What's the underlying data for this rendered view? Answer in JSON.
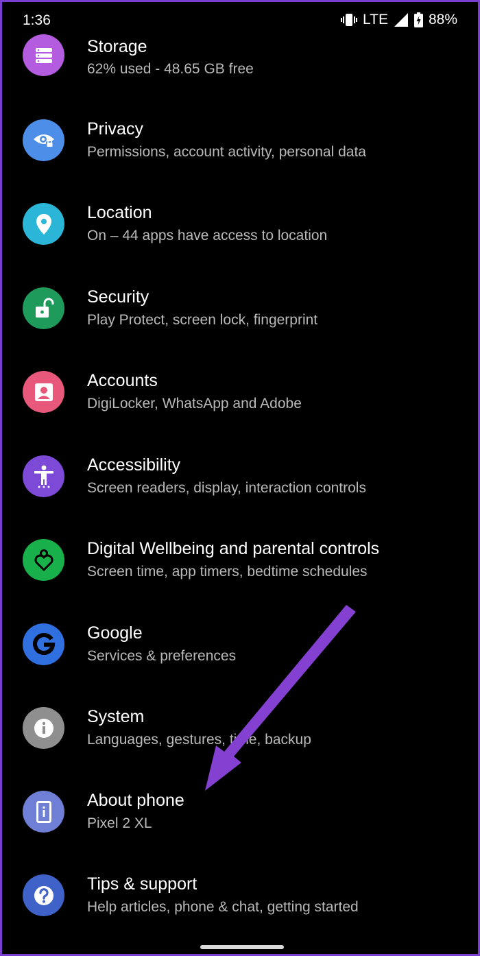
{
  "status_bar": {
    "time": "1:36",
    "network": "LTE",
    "battery": "88%",
    "icons": [
      "vibrate-icon",
      "signal-icon",
      "battery-icon"
    ]
  },
  "settings": {
    "items": [
      {
        "title": "Storage",
        "subtitle": "62% used - 48.65 GB free",
        "icon": "storage-icon",
        "color": "#b35ce0"
      },
      {
        "title": "Privacy",
        "subtitle": "Permissions, account activity, personal data",
        "icon": "eye-lock-icon",
        "color": "#4d8ee8"
      },
      {
        "title": "Location",
        "subtitle": "On – 44 apps have access to location",
        "icon": "location-pin-icon",
        "color": "#2bb5d6"
      },
      {
        "title": "Security",
        "subtitle": "Play Protect, screen lock, fingerprint",
        "icon": "unlock-icon",
        "color": "#1e9a5a"
      },
      {
        "title": "Accounts",
        "subtitle": "DigiLocker, WhatsApp and Adobe",
        "icon": "account-icon",
        "color": "#e8587a"
      },
      {
        "title": "Accessibility",
        "subtitle": "Screen readers, display, interaction controls",
        "icon": "accessibility-icon",
        "color": "#7c4ad6"
      },
      {
        "title": "Digital Wellbeing and parental controls",
        "subtitle": "Screen time, app timers, bedtime schedules",
        "icon": "wellbeing-icon",
        "color": "#17b04a"
      },
      {
        "title": "Google",
        "subtitle": "Services & preferences",
        "icon": "google-icon",
        "color": "#2f6fe0"
      },
      {
        "title": "System",
        "subtitle": "Languages, gestures, time, backup",
        "icon": "info-icon",
        "color": "#8f8f8f"
      },
      {
        "title": "About phone",
        "subtitle": "Pixel 2 XL",
        "icon": "phone-icon",
        "color": "#6f7fd6"
      },
      {
        "title": "Tips & support",
        "subtitle": "Help articles, phone & chat, getting started",
        "icon": "help-icon",
        "color": "#3f62c8"
      }
    ]
  },
  "annotation": {
    "arrow_color": "#8440d0"
  }
}
